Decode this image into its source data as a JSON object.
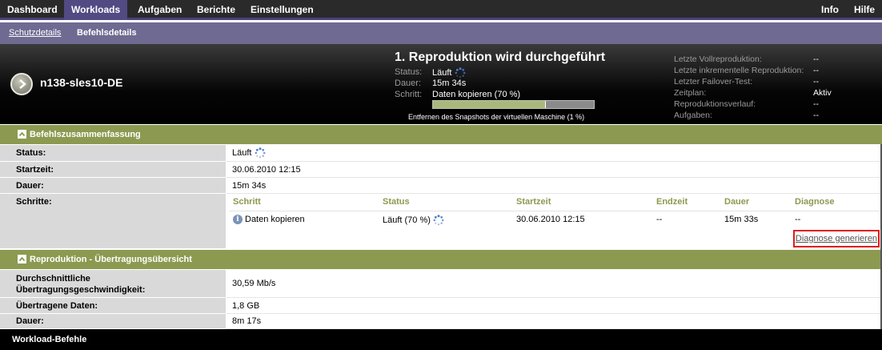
{
  "topnav": {
    "items": [
      "Dashboard",
      "Workloads",
      "Aufgaben",
      "Berichte",
      "Einstellungen"
    ],
    "right": [
      "Info",
      "Hilfe"
    ]
  },
  "subnav": {
    "schutzdetails": "Schutzdetails",
    "befehlsdetails": "Befehlsdetails"
  },
  "header": {
    "workload_name": "n138-sles10-DE",
    "job_title": "1. Reproduktion wird durchgeführt",
    "status_label": "Status:",
    "status_value": "Läuft",
    "dauer_label": "Dauer:",
    "dauer_value": "15m 34s",
    "schritt_label": "Schritt:",
    "schritt_value": "Daten kopieren (70 %)",
    "progress_percent": 70,
    "substep": "Entfernen des Snapshots der virtuellen Maschine (1 %)",
    "right": [
      {
        "label": "Letzte Vollreproduktion:",
        "value": "--"
      },
      {
        "label": "Letzte inkrementelle Reproduktion:",
        "value": "--"
      },
      {
        "label": "Letzter Failover-Test:",
        "value": "--"
      },
      {
        "label": "Zeitplan:",
        "value": "Aktiv"
      },
      {
        "label": "Reproduktionsverlauf:",
        "value": "--"
      },
      {
        "label": "Aufgaben:",
        "value": "--"
      }
    ]
  },
  "summary": {
    "title": "Befehlszusammenfassung",
    "status_label": "Status:",
    "status_value": "Läuft",
    "start_label": "Startzeit:",
    "start_value": "30.06.2010 12:15",
    "dauer_label": "Dauer:",
    "dauer_value": "15m 34s",
    "schritte_label": "Schritte:",
    "steps_columns": [
      "Schritt",
      "Status",
      "Startzeit",
      "Endzeit",
      "Dauer",
      "Diagnose"
    ],
    "steps_rows": [
      [
        "Daten kopieren",
        "Läuft (70 %)",
        "30.06.2010 12:15",
        "--",
        "15m 33s",
        "--"
      ]
    ],
    "diagnose_link": "Diagnose generieren"
  },
  "transfer": {
    "title": "Reproduktion - Übertragungsübersicht",
    "speed_label_1": "Durchschnittliche",
    "speed_label_2": "Übertragungsgeschwindigkeit:",
    "speed_value": "30,59 Mb/s",
    "data_label": "Übertragene Daten:",
    "data_value": "1,8 GB",
    "dauer_label": "Dauer:",
    "dauer_value": "8m 17s"
  },
  "footer": {
    "title": "Workload-Befehle"
  },
  "colors": {
    "section_green": "#8b9a50",
    "nav_active": "#514a83",
    "subnav": "#6f6a92",
    "highlight_red": "#e01b1b"
  }
}
